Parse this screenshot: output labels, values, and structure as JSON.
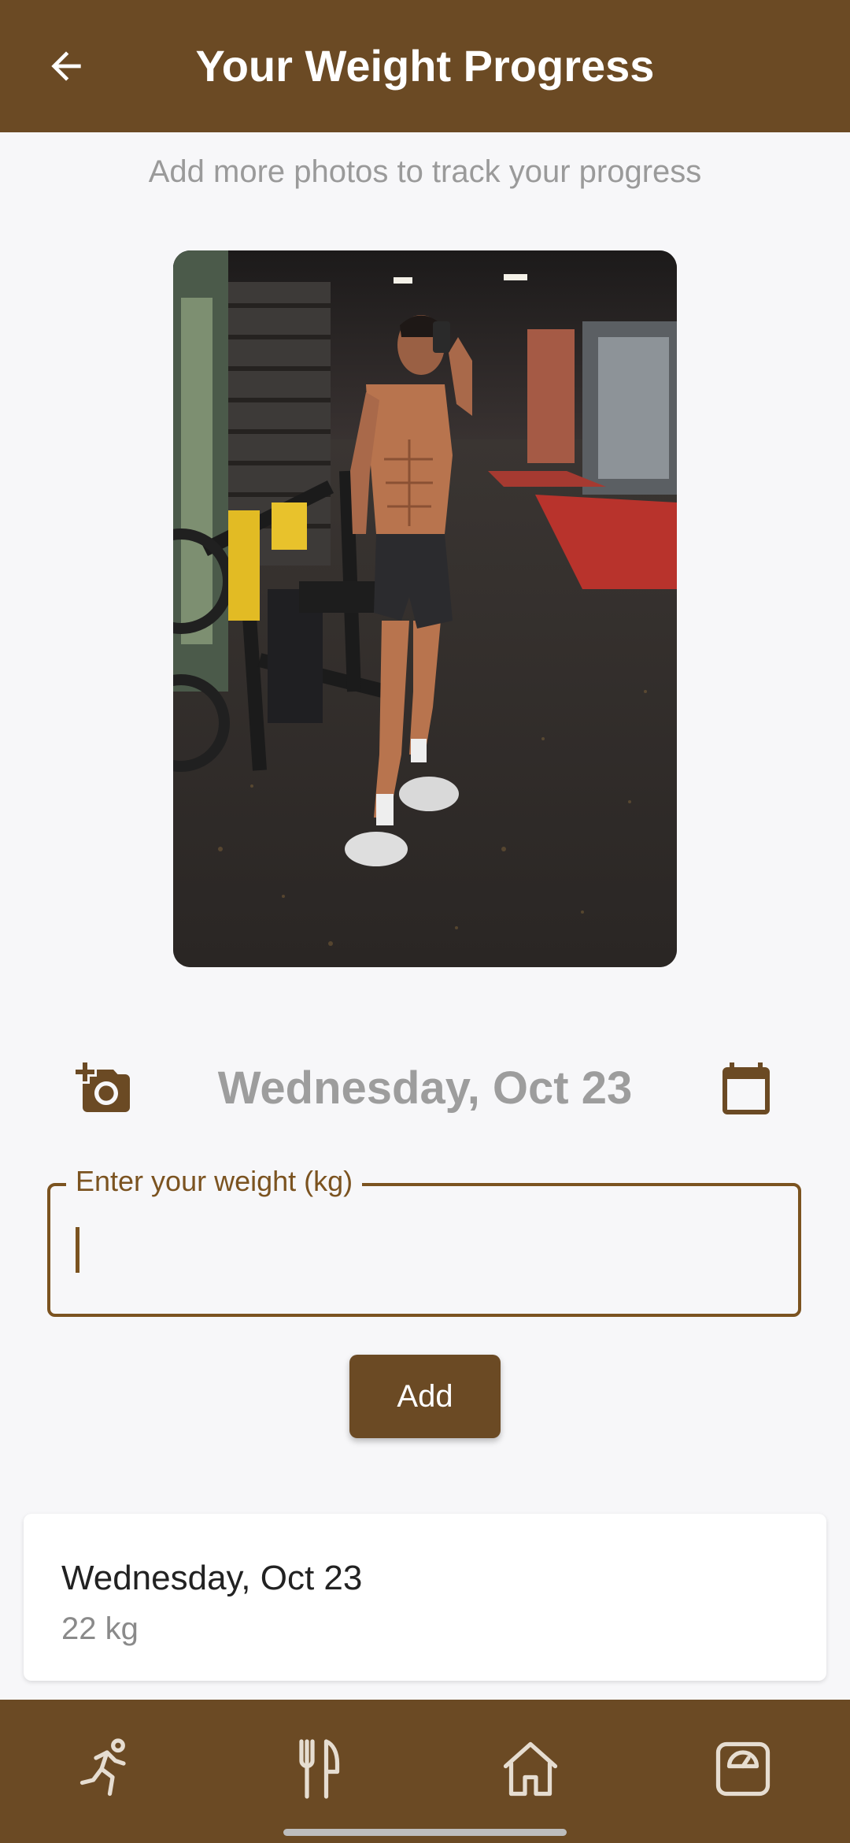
{
  "header": {
    "title": "Your Weight Progress",
    "back_icon": "arrow-left-icon"
  },
  "subtitle": "Add more photos to track your progress",
  "photo": {
    "description_icon": "progress-photo"
  },
  "date_row": {
    "add_photo_icon": "add-photo-icon",
    "selected_date": "Wednesday, Oct 23",
    "calendar_icon": "calendar-icon"
  },
  "weight_input": {
    "label": "Enter your weight (kg)",
    "value": ""
  },
  "add_button": {
    "label": "Add"
  },
  "entries": [
    {
      "date": "Wednesday, Oct 23",
      "weight": "22 kg"
    }
  ],
  "bottom_nav": {
    "items": [
      {
        "icon": "running-icon"
      },
      {
        "icon": "utensils-icon"
      },
      {
        "icon": "home-icon"
      },
      {
        "icon": "scale-icon"
      }
    ]
  },
  "colors": {
    "primary": "#6b4a24",
    "accent": "#7b5320",
    "background": "#f7f7f9"
  }
}
